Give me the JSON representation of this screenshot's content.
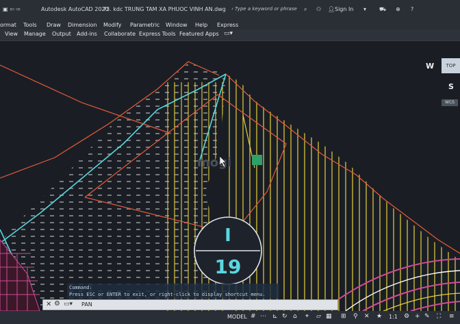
{
  "title_bar": {
    "app_name": "Autodesk AutoCAD 2020",
    "document": "73. kdc TRUNG TAM XA PHUOC VINH AN.dwg",
    "search_placeholder": "Type a keyword or phrase",
    "sign_in": "Sign In"
  },
  "menu": [
    "Format",
    "Tools",
    "Draw",
    "Dimension",
    "Modify",
    "Parametric",
    "Window",
    "Help",
    "Express"
  ],
  "menu_first_visible": "ormat",
  "ribbon_tabs": [
    "View",
    "Manage",
    "Output",
    "Add-ins",
    "Collaborate",
    "Express Tools",
    "Featured Apps"
  ],
  "viewcube": {
    "west": "W",
    "face": "TOP",
    "south": "S",
    "wcs": "WCS"
  },
  "drawing": {
    "label_top": "I",
    "label_bottom": "19",
    "watermark": "mogi"
  },
  "command_history": [
    "Command:",
    "Press ESC or ENTER to exit, or right-click to display shortcut menu."
  ],
  "command_line": {
    "value": "PAN"
  },
  "status_bar": {
    "model": "MODEL",
    "scale": "1:1"
  },
  "colors": {
    "accent_yellow": "#e8d23a",
    "accent_cyan": "#5ad7e0",
    "accent_red": "#e85a3a",
    "accent_magenta": "#d24a9a"
  }
}
